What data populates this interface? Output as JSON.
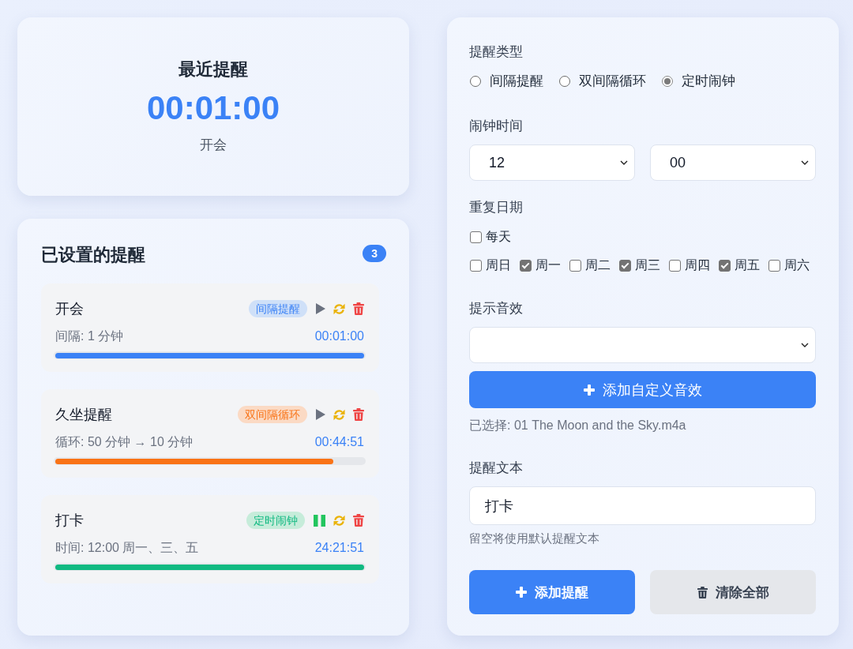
{
  "next_reminder": {
    "title": "最近提醒",
    "countdown": "00:01:00",
    "name": "开会"
  },
  "reminders": {
    "title": "已设置的提醒",
    "count": "3",
    "items": [
      {
        "name": "开会",
        "kind": "interval",
        "type_label": "间隔提醒",
        "running": false,
        "detail": "间隔: 1 分钟",
        "remaining": "00:01:00",
        "level": 1
      },
      {
        "name": "久坐提醒",
        "kind": "dual",
        "type_label": "双间隔循环",
        "running": false,
        "detail": "循环: 50 分钟 → 10 分钟",
        "remaining": "00:44:51",
        "level": 0.9
      },
      {
        "name": "打卡",
        "kind": "alarm",
        "type_label": "定时闹钟",
        "running": true,
        "detail": "时间: 12:00 周一、三、五",
        "remaining": "24:21:51",
        "level": 1
      }
    ]
  },
  "form": {
    "type": {
      "label": "提醒类型",
      "options": [
        {
          "label": "间隔提醒",
          "selected": false
        },
        {
          "label": "双间隔循环",
          "selected": false
        },
        {
          "label": "定时闹钟",
          "selected": true
        }
      ]
    },
    "alarm_time": {
      "label": "闹钟时间",
      "hour": "12",
      "minute": "00"
    },
    "repeat": {
      "label": "重复日期",
      "every_day": {
        "label": "每天",
        "checked": false
      },
      "days": [
        {
          "label": "周日",
          "checked": false
        },
        {
          "label": "周一",
          "checked": true
        },
        {
          "label": "周二",
          "checked": false
        },
        {
          "label": "周三",
          "checked": true
        },
        {
          "label": "周四",
          "checked": false
        },
        {
          "label": "周五",
          "checked": true
        },
        {
          "label": "周六",
          "checked": false
        }
      ]
    },
    "sound": {
      "label": "提示音效",
      "add_button": "添加自定义音效",
      "selected_file": "已选择: 01 The Moon and the Sky.m4a"
    },
    "text": {
      "label": "提醒文本",
      "value": "打卡",
      "hint": "留空将使用默认提醒文本"
    },
    "buttons": [
      {
        "label": "添加提醒",
        "kind": "primary"
      },
      {
        "label": "清除全部",
        "kind": "secondary"
      }
    ]
  }
}
